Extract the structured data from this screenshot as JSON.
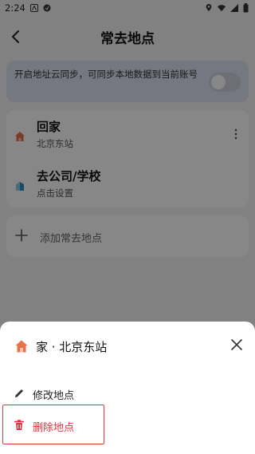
{
  "status_bar": {
    "time": "2:24",
    "icons": [
      "location-icon",
      "wifi-icon",
      "signal-icon",
      "battery-icon"
    ]
  },
  "header": {
    "title": "常去地点"
  },
  "sync": {
    "text": "开启地址云同步，可同步本地数据到当前账号",
    "enabled": false
  },
  "places": [
    {
      "name": "回家",
      "subtitle": "北京东站",
      "icon": "home-icon"
    },
    {
      "name": "去公司/学校",
      "subtitle": "点击设置",
      "icon": "building-icon"
    }
  ],
  "add_place_label": "添加常去地点",
  "sheet": {
    "title": "家 · 北京东站",
    "actions": [
      {
        "label": "修改地点",
        "icon": "pencil-icon"
      },
      {
        "label": "删除地点",
        "icon": "trash-icon"
      }
    ]
  },
  "colors": {
    "accent_home": "#e8704a",
    "accent_work": "#2f8fc9",
    "danger": "#e3353f",
    "sync_card_bg": "#dfe3f3"
  }
}
